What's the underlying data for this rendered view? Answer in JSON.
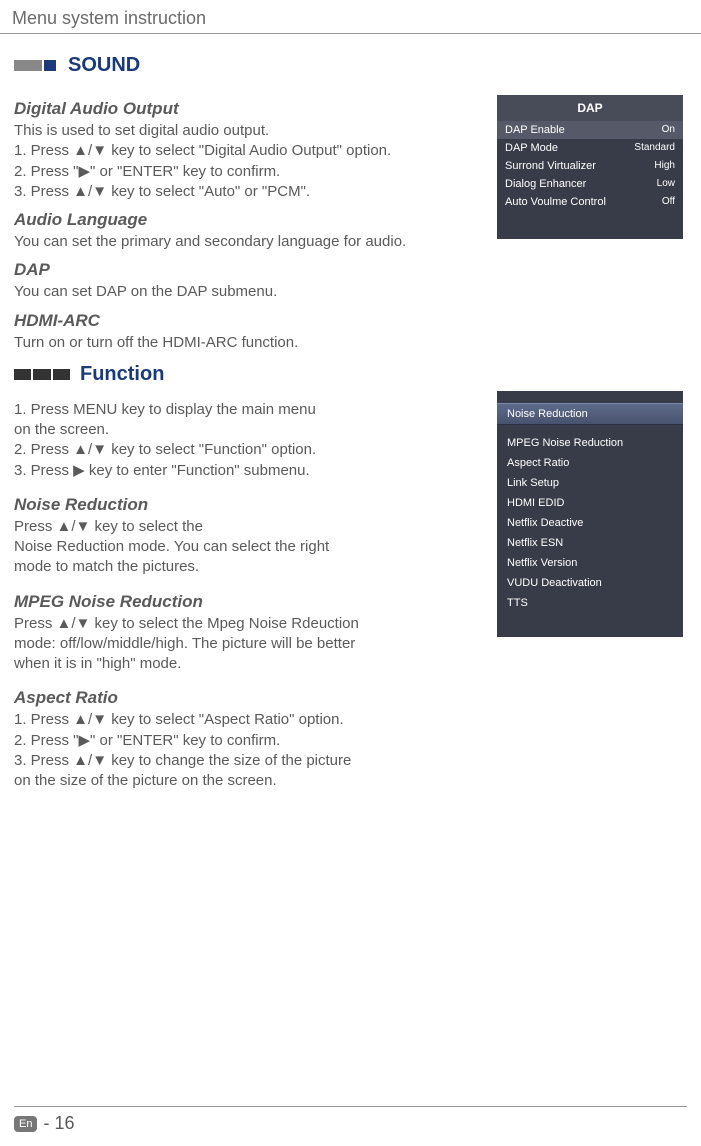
{
  "page": {
    "title": "Menu system instruction",
    "footer_lang": "En",
    "footer_page": "- 16"
  },
  "sound": {
    "heading": "SOUND",
    "digital_audio_output": {
      "title": "Digital Audio Output",
      "l1": "This is used to  set  digital  audio  output.",
      "l2": "1. Press ▲/▼ key to select \"Digital  Audio  Output\" option.",
      "l3": "2. Press \"▶\" or \"ENTER\" key to confirm.",
      "l4": "3. Press ▲/▼ key to select  \"Auto\" or \"PCM\"."
    },
    "audio_language": {
      "title": "Audio Language",
      "l1": "You can set the primary and secondary language for audio."
    },
    "dap": {
      "title": "DAP",
      "l1": "You  can  set  DAP  on  the  DAP  submenu."
    },
    "hdmi_arc": {
      "title": "HDMI-ARC",
      "l1": "Turn on or turn off the HDMI-ARC function."
    }
  },
  "function": {
    "heading": "Function",
    "intro": {
      "l1": "1. Press MENU key to display the main menu",
      "l2": "    on the screen.",
      "l3": "2. Press  ▲/▼ key to select \"Function\" option.",
      "l4": "3. Press ▶ key to enter \"Function\" submenu."
    },
    "noise_reduction": {
      "title": "Noise Reduction",
      "l1": "Press ▲/▼ key to select the",
      "l2": "Noise Reduction mode. You can select the right",
      "l3": "mode to match the pictures."
    },
    "mpeg_noise_reduction": {
      "title": "MPEG Noise Reduction",
      "l1": "Press ▲/▼ key to select the Mpeg Noise Rdeuction",
      "l2": "mode: off/low/middle/high. The picture will be better",
      "l3": "when it is in \"high\" mode."
    },
    "aspect_ratio": {
      "title": "Aspect Ratio",
      "l1": "1. Press ▲/▼ key to select \"Aspect Ratio\"  option.",
      "l2": "2. Press \"▶\" or \"ENTER\" key to confirm.",
      "l3": "3. Press ▲/▼ key to change the size of the picture",
      "l4": "    on the size of the picture on the screen."
    }
  },
  "dap_table": {
    "header": "DAP",
    "rows": [
      {
        "label": "DAP  Enable",
        "value": "On"
      },
      {
        "label": "DAP  Mode",
        "value": "Standard"
      },
      {
        "label": "Surrond  Virtualizer",
        "value": "High"
      },
      {
        "label": "Dialog  Enhancer",
        "value": "Low"
      },
      {
        "label": "Auto Voulme  Control",
        "value": "Off"
      }
    ]
  },
  "func_table": {
    "rows": [
      "Noise Reduction",
      "MPEG Noise Reduction",
      "Aspect Ratio",
      "Link  Setup",
      "HDMI EDID",
      "Netflix Deactive",
      "Netflix ESN",
      "Netflix Version",
      "VUDU Deactivation",
      "TTS"
    ]
  }
}
